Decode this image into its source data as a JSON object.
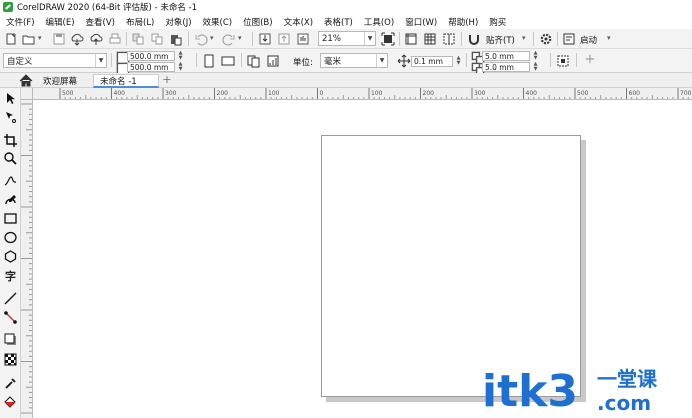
{
  "window": {
    "title": "CorelDRAW 2020 (64-Bit 评估版) - 未命名 -1"
  },
  "menu": [
    {
      "label": "文件(F)"
    },
    {
      "label": "编辑(E)"
    },
    {
      "label": "查看(V)"
    },
    {
      "label": "布局(L)"
    },
    {
      "label": "对象(J)"
    },
    {
      "label": "效果(C)"
    },
    {
      "label": "位图(B)"
    },
    {
      "label": "文本(X)"
    },
    {
      "label": "表格(T)"
    },
    {
      "label": "工具(O)"
    },
    {
      "label": "窗口(W)"
    },
    {
      "label": "帮助(H)"
    },
    {
      "label": "购买"
    }
  ],
  "toolbar": {
    "zoom": "21%",
    "snap_label": "贴齐(T)",
    "launch_label": "启动"
  },
  "propbar": {
    "page_preset": "自定义",
    "width": "500.0 mm",
    "height": "500.0 mm",
    "units_label": "单位:",
    "units_value": "毫米",
    "nudge": "0.1 mm",
    "dup_x": "5.0 mm",
    "dup_y": "5.0 mm"
  },
  "tabs": {
    "welcome": "欢迎屏幕",
    "document": "未命名 -1"
  },
  "ruler": {
    "h_labels": [
      "500",
      "400",
      "300",
      "200",
      "100",
      "0",
      "100",
      "200",
      "300",
      "400",
      "500",
      "600",
      "700"
    ],
    "unit": "毫米"
  },
  "watermark": {
    "text": "itk3",
    "sub_text": "一堂课",
    "domain": ".com"
  },
  "colors": {
    "accent": "#4a90d9",
    "logo": "#2e9e3e",
    "watermark": "#1e6fd0"
  }
}
